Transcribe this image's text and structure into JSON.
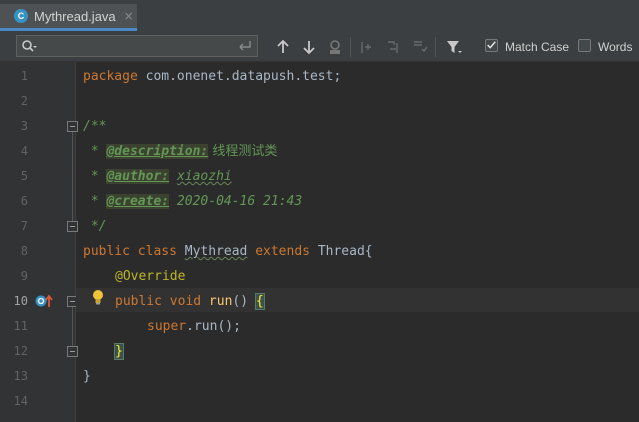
{
  "tab": {
    "icon_letter": "C",
    "title": "Mythread.java",
    "close": "×"
  },
  "findbar": {
    "search_value": "",
    "match_case_label": "Match Case",
    "match_case_checked": true,
    "words_label": "Words",
    "words_checked": false
  },
  "gutter": {
    "line_numbers": [
      "1",
      "2",
      "3",
      "4",
      "5",
      "6",
      "7",
      "8",
      "9",
      "10",
      "11",
      "12",
      "13",
      "14"
    ]
  },
  "code": {
    "l1_kw": "package",
    "l1_rest": " com.onenet.datapush.test;",
    "l3": "/**",
    "l4_star": " * ",
    "l4_tag": "@description:",
    "l4_text": " 线程测试类",
    "l5_star": " * ",
    "l5_tag": "@author:",
    "l5_text": "xiaozhi",
    "l6_star": " * ",
    "l6_tag": "@create:",
    "l6_text": " 2020-04-16 21:43",
    "l7": " */",
    "l8_kw1": "public class ",
    "l8_cls": "Mythread",
    "l8_kw2": " extends ",
    "l8_rest": "Thread{",
    "l9_anno": "@Override",
    "l10_kw": "public void ",
    "l10_fn": "run",
    "l10_rest": "() ",
    "l10_brace": "{",
    "l11_kw": "super",
    "l11_rest": ".run();",
    "l12_brace": "}",
    "l13": "}"
  }
}
